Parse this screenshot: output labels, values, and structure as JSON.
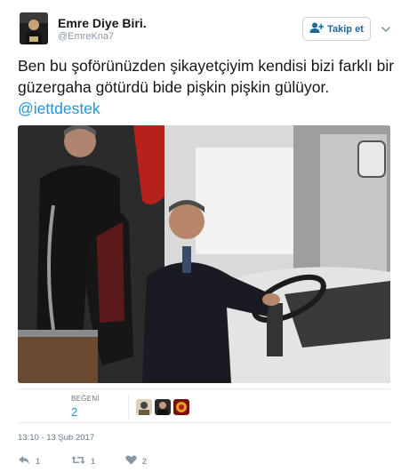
{
  "user": {
    "name": "Emre Diye Biri.",
    "handle": "@EmreKna7"
  },
  "follow_button": {
    "label": "Takip et"
  },
  "tweet": {
    "text": "Ben bu şoförünüzden şikayetçiyim kendisi bizi farklı bir güzergaha götürdü bide pişkin pişkin gülüyor.",
    "mention": "@iettdestek"
  },
  "stats": {
    "likes_label": "BEĞENİ",
    "likes_count": "2"
  },
  "timestamp": "13:10 - 13 Şub 2017",
  "actions": {
    "reply_count": "1",
    "retweet_count": "1",
    "like_count": "2"
  },
  "colors": {
    "link": "#1b95e0",
    "muted": "#8899a6",
    "text": "#14171a",
    "border": "#e6ecf0"
  },
  "icons": [
    "add-user-icon",
    "chevron-down-icon",
    "reply-icon",
    "retweet-icon",
    "heart-icon"
  ]
}
